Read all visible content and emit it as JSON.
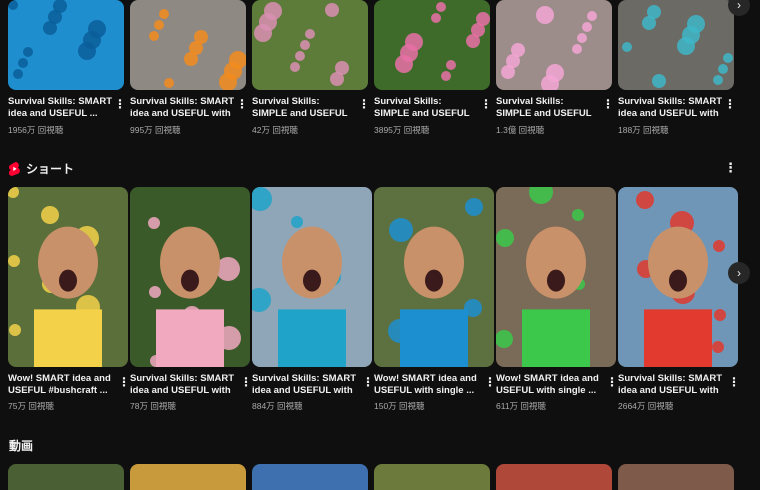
{
  "top_videos": [
    {
      "title": "Survival Skills: SMART idea and USEFUL ...",
      "views": "1956万 回視聴",
      "thumb": {
        "bg": "#1f8ecf",
        "accent": "#0b5e9a"
      }
    },
    {
      "title": "Survival Skills: SMART idea and USEFUL with ...",
      "views": "995万 回視聴",
      "thumb": {
        "bg": "#8e8a83",
        "accent": "#f28b1f"
      }
    },
    {
      "title": "Survival Skills: SIMPLE and USEFUL ...",
      "views": "42万 回視聴",
      "thumb": {
        "bg": "#5d7c3a",
        "accent": "#d98fb3"
      }
    },
    {
      "title": "Survival Skills: SIMPLE and USEFUL #bushcraf...",
      "views": "3895万 回視聴",
      "thumb": {
        "bg": "#3f6b2a",
        "accent": "#e870a6"
      }
    },
    {
      "title": "Survival Skills: SIMPLE and USEFUL with soap...",
      "views": "1.3億 回視聴",
      "thumb": {
        "bg": "#9c8c8a",
        "accent": "#f3a6d3"
      }
    },
    {
      "title": "Survival Skills: SMART idea and USEFUL with ...",
      "views": "188万 回視聴",
      "thumb": {
        "bg": "#6b6a64",
        "accent": "#3fb6c7"
      }
    }
  ],
  "shorts_section": {
    "title": "ショート",
    "icon": "shorts-logo-icon",
    "accent": "#ff0033"
  },
  "shorts": [
    {
      "title": "Wow! SMART idea and USEFUL #bushcraft ...",
      "views": "75万 回視聴",
      "thumb": {
        "bg": "#5b6f3a",
        "accent": "#f3d24a"
      }
    },
    {
      "title": "Survival Skills: SMART idea and USEFUL with ...",
      "views": "78万 回視聴",
      "thumb": {
        "bg": "#3b5a2a",
        "accent": "#f1a9bf"
      }
    },
    {
      "title": "Survival Skills: SMART idea and USEFUL with ...",
      "views": "884万 回視聴",
      "thumb": {
        "bg": "#8fa6b8",
        "accent": "#1fa3c9"
      }
    },
    {
      "title": "Wow! SMART idea and USEFUL with single ...",
      "views": "150万 回視聴",
      "thumb": {
        "bg": "#5d7040",
        "accent": "#1c8fd1"
      }
    },
    {
      "title": "Wow! SMART idea and USEFUL with single ...",
      "views": "611万 回視聴",
      "thumb": {
        "bg": "#7a6b58",
        "accent": "#3cc84a"
      }
    },
    {
      "title": "Survival Skills: SMART idea and USEFUL with ...",
      "views": "2664万 回視聴",
      "thumb": {
        "bg": "#6f96b7",
        "accent": "#e23a2e"
      }
    }
  ],
  "videos_section": {
    "title": "動画"
  },
  "bottom_thumbs": [
    {
      "bg": "#4a5f33"
    },
    {
      "bg": "#c99a3c"
    },
    {
      "bg": "#3e6fae"
    },
    {
      "bg": "#6c7a3b"
    },
    {
      "bg": "#b0483a"
    },
    {
      "bg": "#7e5a4a"
    }
  ],
  "icons": {
    "kebab": "more-vert-icon",
    "next": "chevron-right-icon"
  }
}
